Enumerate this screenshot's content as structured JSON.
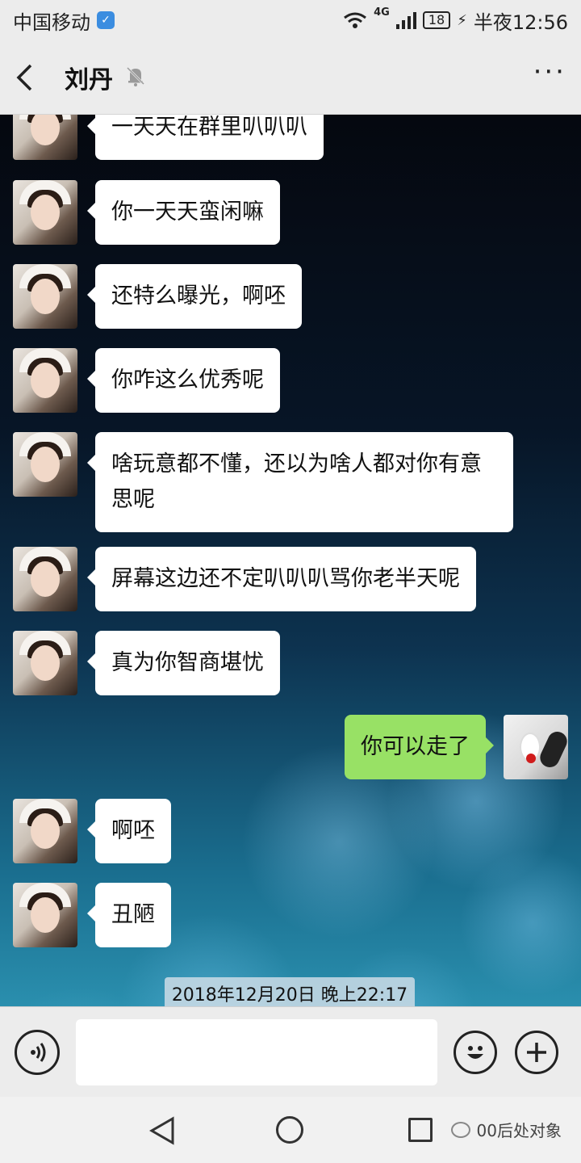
{
  "status_bar": {
    "carrier": "中国移动",
    "network": "4G",
    "battery": "18",
    "time": "半夜12:56"
  },
  "header": {
    "back_icon": "chevron-left-icon",
    "contact_name": "刘丹",
    "mute_icon": "bell-off-icon",
    "more_icon": "more-dots-icon",
    "more_text": "···"
  },
  "messages": [
    {
      "from": "them",
      "text": "一天天在群里叭叭叭"
    },
    {
      "from": "them",
      "text": "你一天天蛮闲嘛"
    },
    {
      "from": "them",
      "text": "还特么曝光，啊呸"
    },
    {
      "from": "them",
      "text": "你咋这么优秀呢"
    },
    {
      "from": "them",
      "text": "啥玩意都不懂，还以为啥人都对你有意思呢"
    },
    {
      "from": "them",
      "text": "屏幕这边还不定叭叭叭骂你老半天呢"
    },
    {
      "from": "them",
      "text": "真为你智商堪忧"
    },
    {
      "from": "me",
      "text": "你可以走了"
    },
    {
      "from": "them",
      "text": "啊呸"
    },
    {
      "from": "them",
      "text": "丑陋"
    }
  ],
  "timestamp": "2018年12月20日 晚上22:17",
  "input_bar": {
    "voice_icon": "voice-icon",
    "input_value": "",
    "emoji_icon": "emoji-icon",
    "plus_icon": "plus-icon"
  },
  "nav_bar": {
    "back_icon": "nav-back-icon",
    "home_icon": "nav-home-icon",
    "recent_icon": "nav-recent-icon",
    "watermark": "00后处对象"
  },
  "colors": {
    "my_bubble": "#98e165",
    "their_bubble": "#ffffff",
    "bar_bg": "#ececec"
  }
}
